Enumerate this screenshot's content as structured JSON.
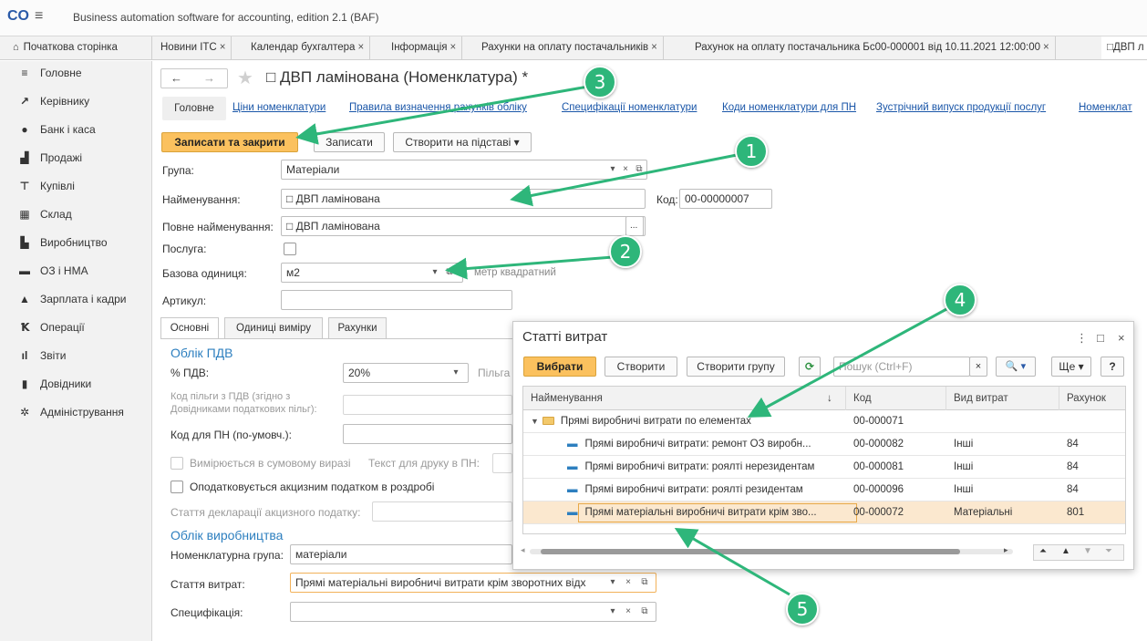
{
  "app": {
    "title": "Business automation software for accounting, edition 2.1  (BAF)",
    "logo": "CO",
    "menu_icon": "hamburger-icon"
  },
  "tabs": [
    {
      "label": "Початкова сторінка",
      "icon": "home-icon"
    },
    {
      "label": "Новини ITC",
      "close": "×"
    },
    {
      "label": "Календар бухгалтера",
      "close": "×"
    },
    {
      "label": "Інформація",
      "close": "×"
    },
    {
      "label": "Рахунки на оплату постачальників",
      "close": "×"
    },
    {
      "label": "Рахунок на оплату постачальника Бс00-000001 від 10.11.2021 12:00:00",
      "close": "×"
    },
    {
      "label": "□ДВП л"
    }
  ],
  "sidebar": {
    "items": [
      {
        "label": "Головне",
        "icon": "menu-lines-icon"
      },
      {
        "label": "Керівнику",
        "icon": "chart-trend-icon"
      },
      {
        "label": "Банк і каса",
        "icon": "coin-icon"
      },
      {
        "label": "Продажі",
        "icon": "bag-icon"
      },
      {
        "label": "Купівлі",
        "icon": "cart-icon"
      },
      {
        "label": "Склад",
        "icon": "warehouse-icon"
      },
      {
        "label": "Виробництво",
        "icon": "factory-icon"
      },
      {
        "label": "ОЗ і НМА",
        "icon": "truck-icon"
      },
      {
        "label": "Зарплата і кадри",
        "icon": "person-icon"
      },
      {
        "label": "Операції",
        "icon": "operations-icon"
      },
      {
        "label": "Звіти",
        "icon": "bar-chart-icon"
      },
      {
        "label": "Довідники",
        "icon": "book-icon"
      },
      {
        "label": "Адміністрування",
        "icon": "gear-icon"
      }
    ]
  },
  "form": {
    "title": "□ ДВП ламінована (Номенклатура) *",
    "nav": {
      "back": "←",
      "forward": "→",
      "star": "★"
    },
    "subnav": {
      "main": "Головне",
      "links": [
        "Ціни номенклатури",
        "Правила визначення рахунків обліку",
        "Специфікації номенклатури",
        "Коди номенклатури для ПН",
        "Зустрічний випуск продукції послуг",
        "Номенклат"
      ]
    },
    "toolbar": {
      "save_close": "Записати та закрити",
      "save": "Записати",
      "create_based": "Створити на підставі",
      "dropdown": "▾"
    },
    "group": {
      "label": "Група:",
      "value": "Матеріали"
    },
    "name": {
      "label": "Найменування:",
      "value": "□ ДВП ламінована"
    },
    "code": {
      "label": "Код:",
      "value": "00-00000007"
    },
    "full_name": {
      "label": "Повне найменування:",
      "value": "□ ДВП ламінована",
      "button": "..."
    },
    "service": {
      "label": "Послуга:"
    },
    "base_unit": {
      "label": "Базова одиниця:",
      "value": "м2",
      "hint": "метр квадратний"
    },
    "article": {
      "label": "Артикул:",
      "value": ""
    },
    "panel_tabs": [
      "Основні",
      "Одиниці виміру",
      "Рахунки"
    ],
    "vat": {
      "section": "Облік ПДВ",
      "rate_label": "% ПДВ:",
      "rate_value": "20%",
      "benefit_label": "Пільга",
      "benefit_code_label_1": "Код пільги з ПДВ (згідно з",
      "benefit_code_label_2": "Довідниками податкових пільг):",
      "pn_code_label": "Код для ПН (по-умовч.):",
      "sum_expr_label": "Вимірюється в сумовому виразі",
      "print_text_label": "Текст для друку в ПН:",
      "excise_label": "Оподатковується акцизним податком в роздробі",
      "excise_decl_label": "Стаття декларації акцизного податку:"
    },
    "production": {
      "section": "Облік виробництва",
      "nom_group_label": "Номенклатурна група:",
      "nom_group_value": "матеріали",
      "cost_item_label": "Стаття витрат:",
      "cost_item_value": "Прямі матеріальні виробничі витрати крім зворотних відх",
      "spec_label": "Специфікація:",
      "spec_value": ""
    },
    "field_icons": {
      "dropdown": "▾",
      "clear": "×",
      "open": "⧉"
    }
  },
  "popup": {
    "title": "Статті витрат",
    "window_icons": {
      "more": "⋮",
      "maximize": "□",
      "close": "×"
    },
    "toolbar": {
      "select": "Вибрати",
      "create": "Створити",
      "create_group": "Створити групу",
      "search_placeholder": "Пошук (Ctrl+F)",
      "more": "Ще",
      "help": "?",
      "clear": "×",
      "search_btn": "🔍 ▾"
    },
    "columns": [
      "Найменування",
      "Код",
      "Вид витрат",
      "Рахунок"
    ],
    "sort_indicator": "↓",
    "rows": [
      {
        "name": "Прямі виробничі витрати по елементах",
        "code": "00-000071",
        "kind": "",
        "account": "",
        "type": "group"
      },
      {
        "name": "Прямі виробничі витрати: ремонт  ОЗ виробн...",
        "code": "00-000082",
        "kind": "Інші",
        "account": "84",
        "type": "item"
      },
      {
        "name": "Прямі виробничі витрати: роялті нерезидентам",
        "code": "00-000081",
        "kind": "Інші",
        "account": "84",
        "type": "item"
      },
      {
        "name": "Прямі виробничі витрати: роялті резидентам",
        "code": "00-000096",
        "kind": "Інші",
        "account": "84",
        "type": "item"
      },
      {
        "name": "Прямі матеріальні виробничі витрати крім зво...",
        "code": "00-000072",
        "kind": "Матеріальні",
        "account": "801",
        "type": "item",
        "selected": true
      }
    ],
    "scroll_icons": {
      "right": "▸",
      "left": "◂",
      "first": "⏶",
      "up": "▲",
      "down": "▼",
      "last": "⏷"
    }
  },
  "callouts": [
    "1",
    "2",
    "3",
    "4",
    "5"
  ],
  "colors": {
    "accent_button": "#fbc15e",
    "link": "#1a56a8",
    "section_title": "#2d7fbf",
    "callout": "#2eb67a",
    "selected_row": "#fbe8cf"
  }
}
